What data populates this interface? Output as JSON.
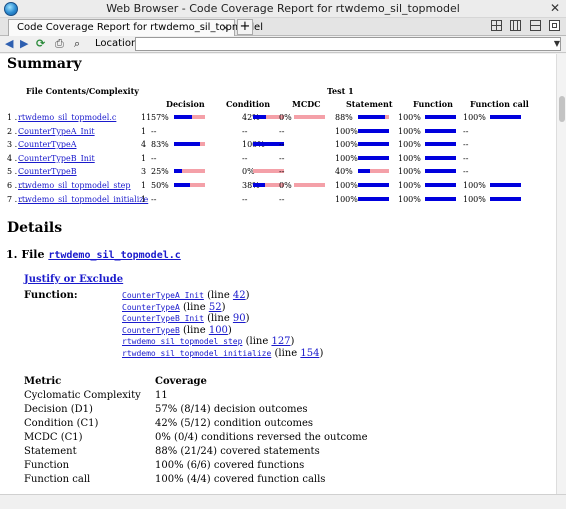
{
  "window": {
    "title": "Web Browser - Code Coverage Report for rtwdemo_sil_topmodel"
  },
  "tab": {
    "label": "Code Coverage Report for rtwdemo_sil_topmodel",
    "close": "×",
    "new_tab": "+"
  },
  "toolbar": {
    "location_label": "Location:",
    "location_value": ""
  },
  "summary": {
    "title": "Summary",
    "col_file": "File Contents/Complexity",
    "test_label": "Test 1",
    "col_decision": "Decision",
    "col_condition": "Condition",
    "col_mcdc": "MCDC",
    "col_statement": "Statement",
    "col_function": "Function",
    "col_function_call": "Function call",
    "rows": [
      {
        "num": "1 .",
        "name": "rtwdemo_sil_topmodel.c",
        "cx": "11",
        "dec": "57%",
        "dec_f": 0.57,
        "cond": "42%",
        "cond_f": 0.42,
        "mcdc": "0%",
        "mcdc_f": 0,
        "stmt": "88%",
        "stmt_f": 0.88,
        "fn": "100%",
        "fn_f": 1,
        "fc": "100%",
        "fc_f": 1
      },
      {
        "num": "2 . . .",
        "name": "CounterTypeA_Init",
        "cx": "1",
        "dec": "--",
        "dec_f": null,
        "cond": "--",
        "cond_f": null,
        "mcdc": "--",
        "mcdc_f": null,
        "stmt": "100%",
        "stmt_f": 1,
        "fn": "100%",
        "fn_f": 1,
        "fc": "--",
        "fc_f": null
      },
      {
        "num": "3 . . .",
        "name": "CounterTypeA",
        "cx": "4",
        "dec": "83%",
        "dec_f": 0.83,
        "cond": "100%",
        "cond_f": 1,
        "mcdc": "--",
        "mcdc_f": null,
        "stmt": "100%",
        "stmt_f": 1,
        "fn": "100%",
        "fn_f": 1,
        "fc": "--",
        "fc_f": null
      },
      {
        "num": "4 . . .",
        "name": "CounterTypeB_Init",
        "cx": "1",
        "dec": "--",
        "dec_f": null,
        "cond": "--",
        "cond_f": null,
        "mcdc": "--",
        "mcdc_f": null,
        "stmt": "100%",
        "stmt_f": 1,
        "fn": "100%",
        "fn_f": 1,
        "fc": "--",
        "fc_f": null
      },
      {
        "num": "5 . . .",
        "name": "CounterTypeB",
        "cx": "3",
        "dec": "25%",
        "dec_f": 0.25,
        "cond": "0%",
        "cond_f": 0,
        "mcdc": "--",
        "mcdc_f": null,
        "stmt": "40%",
        "stmt_f": 0.4,
        "fn": "100%",
        "fn_f": 1,
        "fc": "--",
        "fc_f": null
      },
      {
        "num": "6 . . .",
        "name": "rtwdemo_sil_topmodel_step",
        "cx": "1",
        "dec": "50%",
        "dec_f": 0.5,
        "cond": "38%",
        "cond_f": 0.38,
        "mcdc": "0%",
        "mcdc_f": 0,
        "stmt": "100%",
        "stmt_f": 1,
        "fn": "100%",
        "fn_f": 1,
        "fc": "100%",
        "fc_f": 1
      },
      {
        "num": "7 . . .",
        "name": "rtwdemo_sil_topmodel_initialize",
        "cx": "1",
        "dec": "--",
        "dec_f": null,
        "cond": "--",
        "cond_f": null,
        "mcdc": "--",
        "mcdc_f": null,
        "stmt": "100%",
        "stmt_f": 1,
        "fn": "100%",
        "fn_f": 1,
        "fc": "100%",
        "fc_f": 1
      }
    ]
  },
  "details": {
    "title": "Details",
    "file_prefix": "1. File",
    "file_name": "rtwdemo_sil_topmodel.c",
    "justify_link": "Justify or Exclude",
    "function_label": "Function:",
    "functions": [
      {
        "name": "CounterTypeA_Init",
        "pre": "(line",
        "line": "42",
        "post": ")"
      },
      {
        "name": "CounterTypeA",
        "pre": "(line",
        "line": "52",
        "post": ")"
      },
      {
        "name": "CounterTypeB_Init",
        "pre": "(line",
        "line": "90",
        "post": ")"
      },
      {
        "name": "CounterTypeB",
        "pre": "(line",
        "line": "100",
        "post": ")"
      },
      {
        "name": "rtwdemo_sil_topmodel_step",
        "pre": "(line",
        "line": "127",
        "post": ")"
      },
      {
        "name": "rtwdemo_sil_topmodel_initialize",
        "pre": "(line",
        "line": "154",
        "post": ")"
      }
    ],
    "metric_header": "Metric",
    "coverage_header": "Coverage",
    "metrics": [
      {
        "name": "Cyclomatic Complexity",
        "value": "11"
      },
      {
        "name": "Decision (D1)",
        "value": "57% (8/14) decision outcomes"
      },
      {
        "name": "Condition (C1)",
        "value": "42% (5/12) condition outcomes"
      },
      {
        "name": "MCDC (C1)",
        "value": "0% (0/4) conditions reversed the outcome"
      },
      {
        "name": "Statement",
        "value": "88% (21/24) covered statements"
      },
      {
        "name": "Function",
        "value": "100% (6/6) covered functions"
      },
      {
        "name": "Function call",
        "value": "100% (4/4) covered function calls"
      }
    ]
  },
  "colors": {
    "covered": "#0000dd",
    "uncovered": "#f4a0a8",
    "link": "#1a1acc"
  }
}
